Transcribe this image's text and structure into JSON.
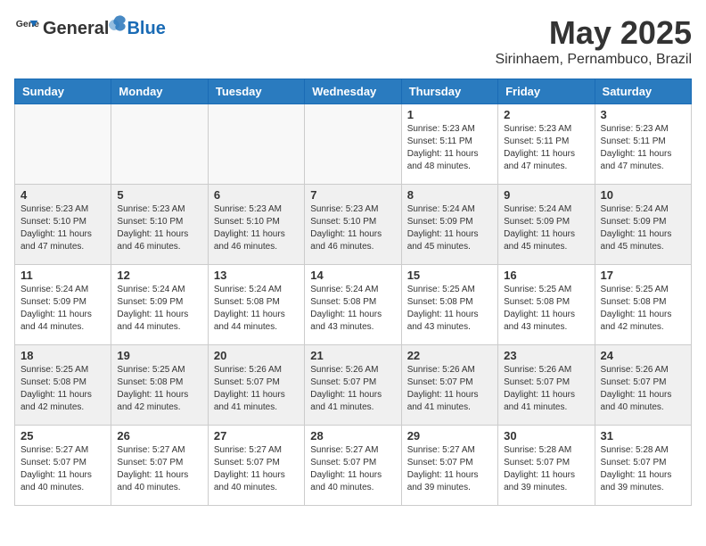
{
  "header": {
    "logo_general": "General",
    "logo_blue": "Blue",
    "month_title": "May 2025",
    "location": "Sirinhaem, Pernambuco, Brazil"
  },
  "weekdays": [
    "Sunday",
    "Monday",
    "Tuesday",
    "Wednesday",
    "Thursday",
    "Friday",
    "Saturday"
  ],
  "weeks": [
    [
      {
        "day": "",
        "empty": true
      },
      {
        "day": "",
        "empty": true
      },
      {
        "day": "",
        "empty": true
      },
      {
        "day": "",
        "empty": true
      },
      {
        "day": "1",
        "info": "Sunrise: 5:23 AM\nSunset: 5:11 PM\nDaylight: 11 hours\nand 48 minutes."
      },
      {
        "day": "2",
        "info": "Sunrise: 5:23 AM\nSunset: 5:11 PM\nDaylight: 11 hours\nand 47 minutes."
      },
      {
        "day": "3",
        "info": "Sunrise: 5:23 AM\nSunset: 5:11 PM\nDaylight: 11 hours\nand 47 minutes."
      }
    ],
    [
      {
        "day": "4",
        "info": "Sunrise: 5:23 AM\nSunset: 5:10 PM\nDaylight: 11 hours\nand 47 minutes."
      },
      {
        "day": "5",
        "info": "Sunrise: 5:23 AM\nSunset: 5:10 PM\nDaylight: 11 hours\nand 46 minutes."
      },
      {
        "day": "6",
        "info": "Sunrise: 5:23 AM\nSunset: 5:10 PM\nDaylight: 11 hours\nand 46 minutes."
      },
      {
        "day": "7",
        "info": "Sunrise: 5:23 AM\nSunset: 5:10 PM\nDaylight: 11 hours\nand 46 minutes."
      },
      {
        "day": "8",
        "info": "Sunrise: 5:24 AM\nSunset: 5:09 PM\nDaylight: 11 hours\nand 45 minutes."
      },
      {
        "day": "9",
        "info": "Sunrise: 5:24 AM\nSunset: 5:09 PM\nDaylight: 11 hours\nand 45 minutes."
      },
      {
        "day": "10",
        "info": "Sunrise: 5:24 AM\nSunset: 5:09 PM\nDaylight: 11 hours\nand 45 minutes."
      }
    ],
    [
      {
        "day": "11",
        "info": "Sunrise: 5:24 AM\nSunset: 5:09 PM\nDaylight: 11 hours\nand 44 minutes."
      },
      {
        "day": "12",
        "info": "Sunrise: 5:24 AM\nSunset: 5:09 PM\nDaylight: 11 hours\nand 44 minutes."
      },
      {
        "day": "13",
        "info": "Sunrise: 5:24 AM\nSunset: 5:08 PM\nDaylight: 11 hours\nand 44 minutes."
      },
      {
        "day": "14",
        "info": "Sunrise: 5:24 AM\nSunset: 5:08 PM\nDaylight: 11 hours\nand 43 minutes."
      },
      {
        "day": "15",
        "info": "Sunrise: 5:25 AM\nSunset: 5:08 PM\nDaylight: 11 hours\nand 43 minutes."
      },
      {
        "day": "16",
        "info": "Sunrise: 5:25 AM\nSunset: 5:08 PM\nDaylight: 11 hours\nand 43 minutes."
      },
      {
        "day": "17",
        "info": "Sunrise: 5:25 AM\nSunset: 5:08 PM\nDaylight: 11 hours\nand 42 minutes."
      }
    ],
    [
      {
        "day": "18",
        "info": "Sunrise: 5:25 AM\nSunset: 5:08 PM\nDaylight: 11 hours\nand 42 minutes."
      },
      {
        "day": "19",
        "info": "Sunrise: 5:25 AM\nSunset: 5:08 PM\nDaylight: 11 hours\nand 42 minutes."
      },
      {
        "day": "20",
        "info": "Sunrise: 5:26 AM\nSunset: 5:07 PM\nDaylight: 11 hours\nand 41 minutes."
      },
      {
        "day": "21",
        "info": "Sunrise: 5:26 AM\nSunset: 5:07 PM\nDaylight: 11 hours\nand 41 minutes."
      },
      {
        "day": "22",
        "info": "Sunrise: 5:26 AM\nSunset: 5:07 PM\nDaylight: 11 hours\nand 41 minutes."
      },
      {
        "day": "23",
        "info": "Sunrise: 5:26 AM\nSunset: 5:07 PM\nDaylight: 11 hours\nand 41 minutes."
      },
      {
        "day": "24",
        "info": "Sunrise: 5:26 AM\nSunset: 5:07 PM\nDaylight: 11 hours\nand 40 minutes."
      }
    ],
    [
      {
        "day": "25",
        "info": "Sunrise: 5:27 AM\nSunset: 5:07 PM\nDaylight: 11 hours\nand 40 minutes."
      },
      {
        "day": "26",
        "info": "Sunrise: 5:27 AM\nSunset: 5:07 PM\nDaylight: 11 hours\nand 40 minutes."
      },
      {
        "day": "27",
        "info": "Sunrise: 5:27 AM\nSunset: 5:07 PM\nDaylight: 11 hours\nand 40 minutes."
      },
      {
        "day": "28",
        "info": "Sunrise: 5:27 AM\nSunset: 5:07 PM\nDaylight: 11 hours\nand 40 minutes."
      },
      {
        "day": "29",
        "info": "Sunrise: 5:27 AM\nSunset: 5:07 PM\nDaylight: 11 hours\nand 39 minutes."
      },
      {
        "day": "30",
        "info": "Sunrise: 5:28 AM\nSunset: 5:07 PM\nDaylight: 11 hours\nand 39 minutes."
      },
      {
        "day": "31",
        "info": "Sunrise: 5:28 AM\nSunset: 5:07 PM\nDaylight: 11 hours\nand 39 minutes."
      }
    ]
  ]
}
